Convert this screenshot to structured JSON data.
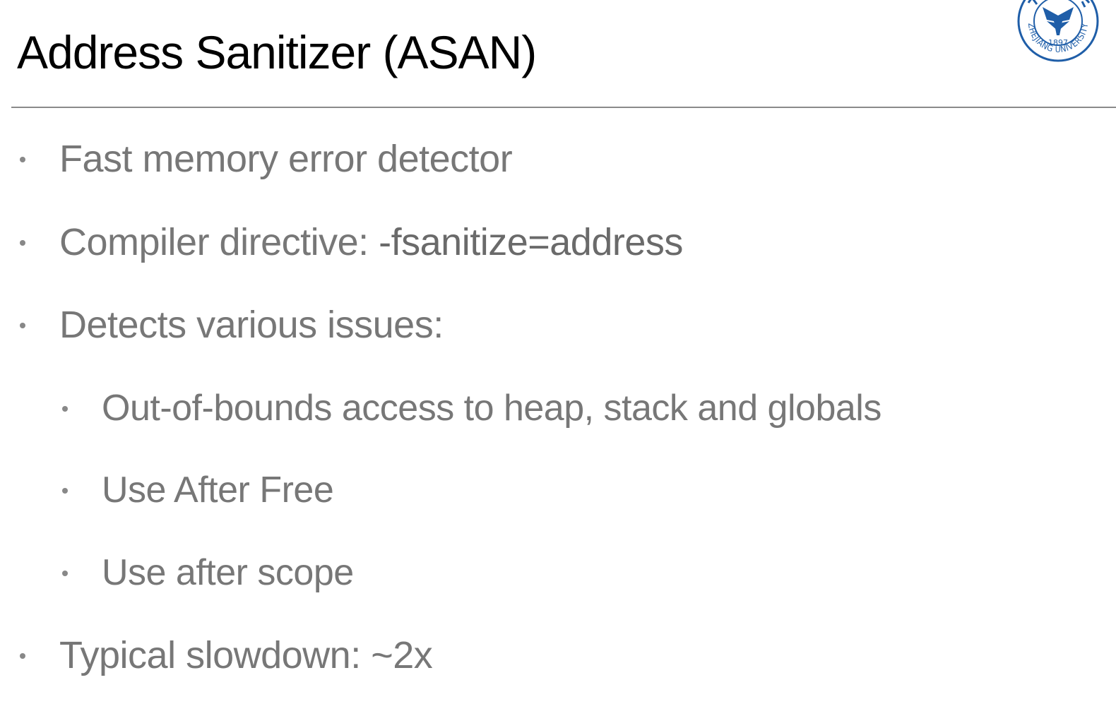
{
  "slide": {
    "title": "Address Sanitizer (ASAN)",
    "logo": {
      "icon": "zhejiang-university-seal",
      "text": "ZHEJIANG UNIVERSITY",
      "year": "1897",
      "color": "#1f5ea8"
    },
    "bullets": [
      {
        "text": "Fast memory error detector"
      },
      {
        "prefix": "Compiler directive: ",
        "code": "-fsanitize=address"
      },
      {
        "text": "Detects various issues:"
      },
      {
        "text": "Out-of-bounds access to heap, stack and globals"
      },
      {
        "text": "Use After Free"
      },
      {
        "text": "Use after scope"
      },
      {
        "text": "Typical slowdown: ~2x"
      }
    ]
  },
  "colors": {
    "title": "#000000",
    "body_text": "#777777",
    "rule": "#8a8a8a",
    "logo": "#1f5ea8"
  }
}
